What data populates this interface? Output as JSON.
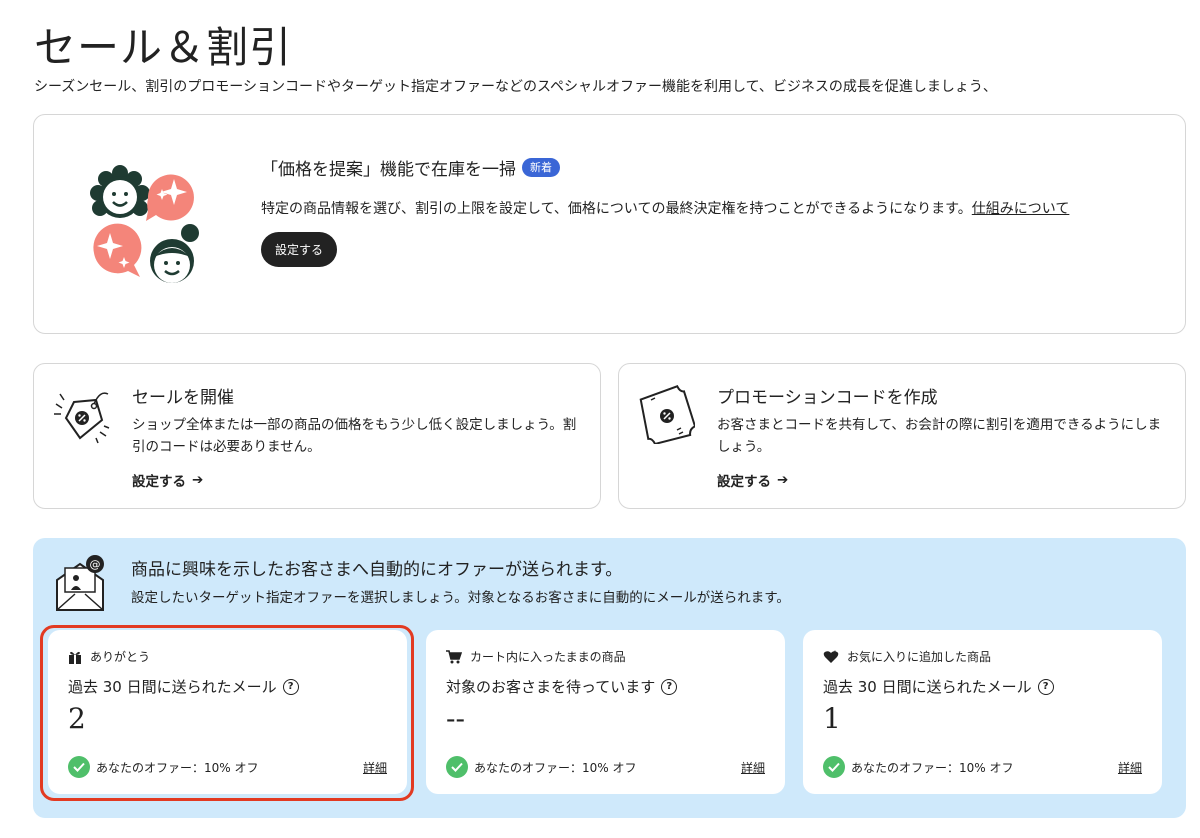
{
  "page": {
    "title": "セール＆割引",
    "subtitle": "シーズンセール、割引のプロモーションコードやターゲット指定オファーなどのスペシャルオファー機能を利用して、ビジネスの成長を促進しましょう、"
  },
  "hero": {
    "title": "「価格を提案」機能で在庫を一掃",
    "badge": "新着",
    "description": "特定の商品情報を選び、割引の上限を設定して、価格についての最終決定権を持つことができるようになります。",
    "link": "仕組みについて",
    "button": "設定する"
  },
  "sale_card": {
    "title": "セールを開催",
    "description": "ショップ全体または一部の商品の価格をもう少し低く設定しましょう。割引のコードは必要ありません。",
    "action": "設定する",
    "icon": "price-tag-icon"
  },
  "promo_card": {
    "title": "プロモーションコードを作成",
    "description": "お客さまとコードを共有して、お会計の際に割引を適用できるようにしましょう。",
    "action": "設定する",
    "icon": "coupon-ticket-icon"
  },
  "auto_offers": {
    "title": "商品に興味を示したお客さまへ自動的にオファーが送られます。",
    "description": "設定したいターゲット指定オファーを選択しましょう。対象となるお客さまに自動的にメールが送られます。",
    "cards": [
      {
        "label": "ありがとう",
        "icon": "gift-icon",
        "metric": "過去 30 日間に送られたメール",
        "value": "2",
        "status": "あなたのオファー：10% オフ",
        "detail": "詳細",
        "highlighted": true
      },
      {
        "label": "カート内に入ったままの商品",
        "icon": "cart-icon",
        "metric": "対象のお客さまを待っています",
        "value": "--",
        "status": "あなたのオファー：10% オフ",
        "detail": "詳細",
        "highlighted": false
      },
      {
        "label": "お気に入りに追加した商品",
        "icon": "heart-icon",
        "metric": "過去 30 日間に送られたメール",
        "value": "1",
        "status": "あなたのオファー：10% オフ",
        "detail": "詳細",
        "highlighted": false
      }
    ]
  },
  "colors": {
    "accent_blue": "#3a66d6",
    "panel_blue": "#cfe9fb",
    "salmon": "#f4857a",
    "dark_green": "#1f3b32",
    "check_green": "#4fbf6a",
    "highlight_red": "#e23a22"
  }
}
